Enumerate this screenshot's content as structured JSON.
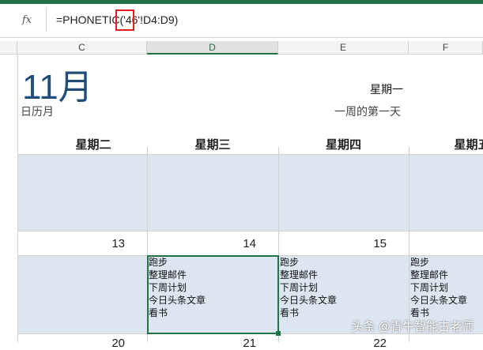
{
  "formula_bar": {
    "fx": "fx",
    "formula": "=PHONETIC('46'!D4:D9)"
  },
  "columns": [
    "C",
    "D",
    "E",
    "F"
  ],
  "calendar": {
    "month": "11月",
    "subtitle": "日历月",
    "start_day": "星期一",
    "start_day_label": "一周的第一天",
    "weekdays": [
      "星期二",
      "星期三",
      "星期四",
      "星期五"
    ],
    "dates": [
      "13",
      "14",
      "15"
    ],
    "next_dates": [
      "20",
      "21",
      "22"
    ],
    "tasks": [
      "跑步",
      "整理邮件",
      "下周计划",
      "今日头条文章",
      "看书"
    ]
  },
  "watermark": "头条 @青牛智能古老师",
  "colors": {
    "accent": "#217346",
    "month": "#1f4e79",
    "shade": "#dce6f1"
  }
}
